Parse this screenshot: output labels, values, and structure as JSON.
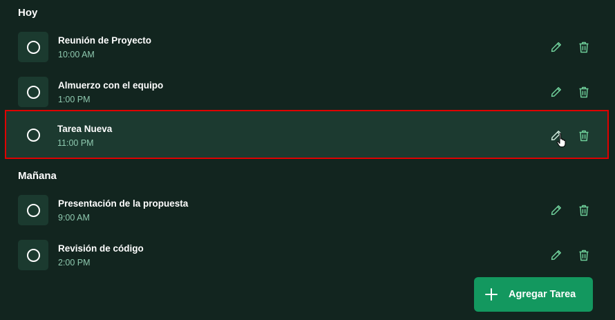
{
  "sections": [
    {
      "title": "Hoy",
      "tasks": [
        {
          "title": "Reunión de Proyecto",
          "time": "10:00 AM"
        },
        {
          "title": "Almuerzo con el equipo",
          "time": "1:00 PM"
        },
        {
          "title": "Tarea Nueva",
          "time": "11:00 PM"
        }
      ]
    },
    {
      "title": "Mañana",
      "tasks": [
        {
          "title": "Presentación de la propuesta",
          "time": "9:00 AM"
        },
        {
          "title": "Revisión de código",
          "time": "2:00 PM"
        }
      ]
    }
  ],
  "add_button": {
    "label": "Agregar Tarea",
    "icon": "plus-icon"
  },
  "icons": {
    "edit": "pencil-icon",
    "delete": "trash-icon",
    "checkbox": "circle-checkbox-icon"
  },
  "colors": {
    "background": "#12251f",
    "card": "#1b3a2f",
    "accent": "#13985f",
    "time_text": "#8fcab0",
    "icon": "#6fcf9a",
    "highlight_border": "#e00000"
  }
}
